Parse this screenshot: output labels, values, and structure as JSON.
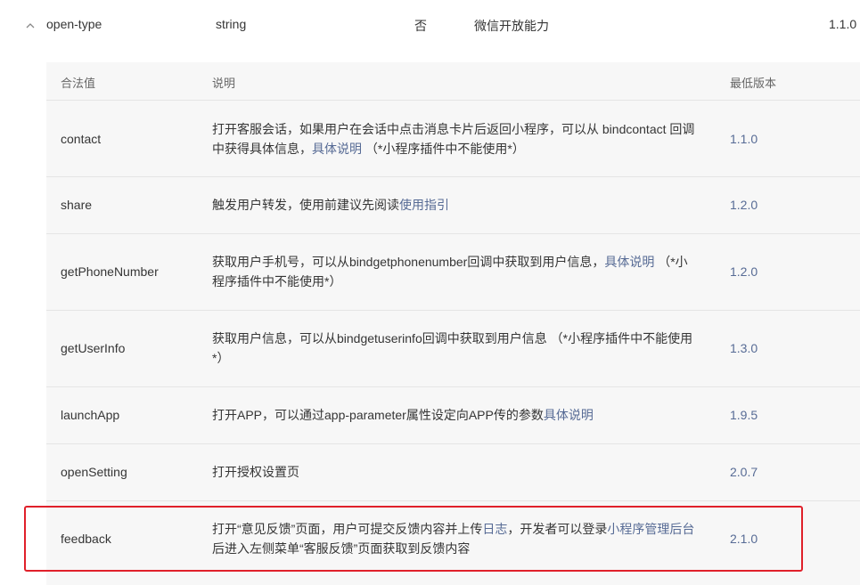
{
  "property": {
    "name": "open-type",
    "type": "string",
    "required": "否",
    "description": "微信开放能力",
    "version": "1.1.0"
  },
  "table": {
    "headers": {
      "value": "合法值",
      "description": "说明",
      "version": "最低版本"
    },
    "rows": [
      {
        "value": "contact",
        "desc_before": "打开客服会话，如果用户在会话中点击消息卡片后返回小程序，可以从 bindcontact 回调中获得具体信息，",
        "link1": "具体说明",
        "desc_middle": " （*小程序插件中不能使用*）",
        "link2": "",
        "desc_after": "",
        "version": "1.1.0"
      },
      {
        "value": "share",
        "desc_before": "触发用户转发，使用前建议先阅读",
        "link1": "使用指引",
        "desc_middle": "",
        "link2": "",
        "desc_after": "",
        "version": "1.2.0"
      },
      {
        "value": "getPhoneNumber",
        "desc_before": "获取用户手机号，可以从bindgetphonenumber回调中获取到用户信息，",
        "link1": "具体说明",
        "desc_middle": " （*小程序插件中不能使用*）",
        "link2": "",
        "desc_after": "",
        "version": "1.2.0"
      },
      {
        "value": "getUserInfo",
        "desc_before": "获取用户信息，可以从bindgetuserinfo回调中获取到用户信息 （*小程序插件中不能使用*）",
        "link1": "",
        "desc_middle": "",
        "link2": "",
        "desc_after": "",
        "version": "1.3.0"
      },
      {
        "value": "launchApp",
        "desc_before": "打开APP，可以通过app-parameter属性设定向APP传的参数",
        "link1": "具体说明",
        "desc_middle": "",
        "link2": "",
        "desc_after": "",
        "version": "1.9.5"
      },
      {
        "value": "openSetting",
        "desc_before": "打开授权设置页",
        "link1": "",
        "desc_middle": "",
        "link2": "",
        "desc_after": "",
        "version": "2.0.7"
      },
      {
        "value": "feedback",
        "desc_before": "打开“意见反馈”页面，用户可提交反馈内容并上传",
        "link1": "日志",
        "desc_middle": "，开发者可以登录",
        "link2": "小程序管理后台",
        "desc_after": "后进入左侧菜单“客服反馈”页面获取到反馈内容",
        "version": "2.1.0"
      }
    ]
  },
  "colors": {
    "link": "#576b95",
    "highlight": "#e0202a",
    "subtable_bg": "#f7f7f7"
  },
  "icons": {
    "collapse": "chevron-up-icon"
  }
}
